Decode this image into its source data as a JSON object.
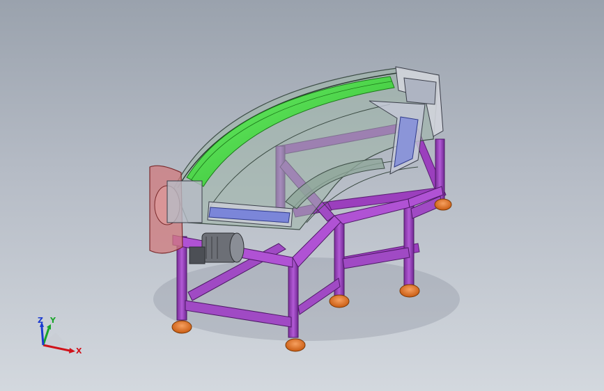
{
  "viewport": {
    "background": "#b6bcc6",
    "model": {
      "frame_color": "#9b3fbd",
      "belt_color": "#3fe03a",
      "foot_color": "#e8751c",
      "motor_color": "#6c6f76",
      "guard_color": "#c9686a"
    },
    "triad": {
      "x_label": "X",
      "y_label": "Y",
      "z_label": "Z",
      "x_color": "#d0121a",
      "y_color": "#1aa52a",
      "z_color": "#1a3ad0"
    }
  }
}
